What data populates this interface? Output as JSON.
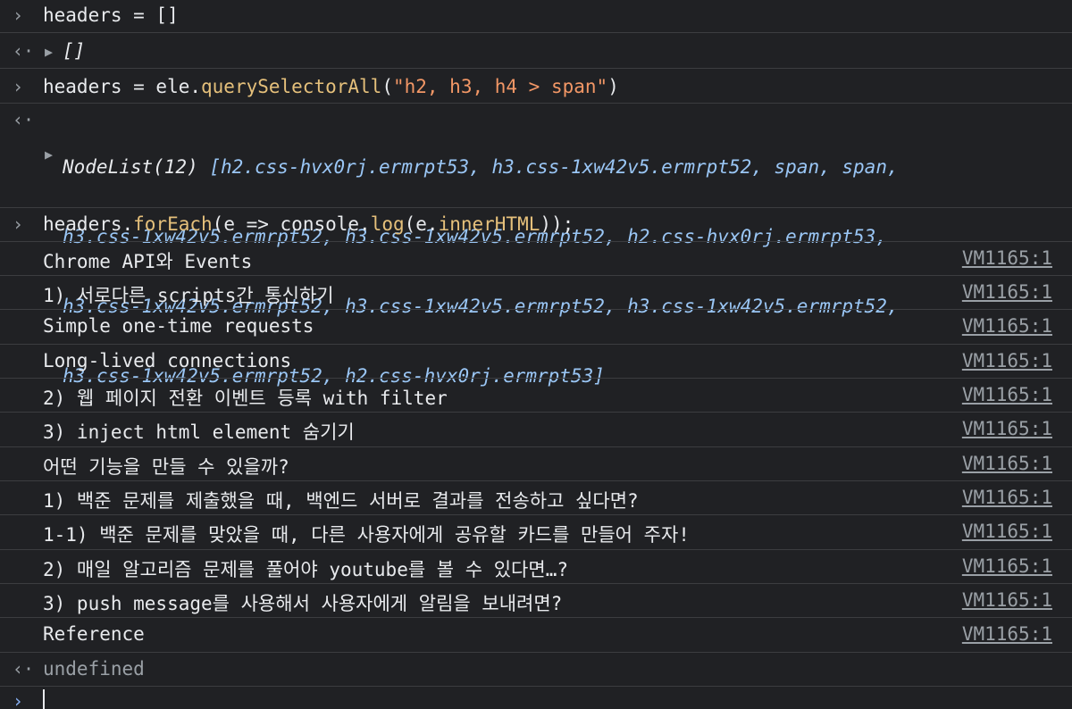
{
  "icons": {
    "input": "›",
    "result": "‹·",
    "expand": "▶"
  },
  "cmd1": {
    "text": "headers = []",
    "result": "[]"
  },
  "cmd2": {
    "lhs": "headers = ele.",
    "method": "querySelectorAll",
    "open": "(",
    "arg": "\"h2, h3, h4 > span\"",
    "close": ")"
  },
  "nodelist": {
    "prefix": "NodeList(12) ",
    "lines": [
      "[h2.css-hvx0rj.ermrpt53, h3.css-1xw42v5.ermrpt52, span, span,",
      "h3.css-1xw42v5.ermrpt52, h3.css-1xw42v5.ermrpt52, h2.css-hvx0rj.ermrpt53,",
      "h3.css-1xw42v5.ermrpt52, h3.css-1xw42v5.ermrpt52, h3.css-1xw42v5.ermrpt52,",
      "h3.css-1xw42v5.ermrpt52, h2.css-hvx0rj.ermrpt53]"
    ]
  },
  "cmd3": {
    "p1": "headers.",
    "p2": "forEach",
    "p3": "(e => console.",
    "p4": "log",
    "p5": "(e.",
    "p6": "innerHTML",
    "p7": "));"
  },
  "logs": [
    {
      "text": "Chrome API와 Events",
      "source": "VM1165:1"
    },
    {
      "text": "1) 서로다른 scripts간 통신하기",
      "source": "VM1165:1"
    },
    {
      "text": "Simple one-time requests",
      "source": "VM1165:1"
    },
    {
      "text": "Long-lived connections",
      "source": "VM1165:1"
    },
    {
      "text": "2) 웹 페이지 전환 이벤트 등록 with filter",
      "source": "VM1165:1"
    },
    {
      "text": "3) inject html element 숨기기",
      "source": "VM1165:1"
    },
    {
      "text": "어떤 기능을 만들 수 있을까?",
      "source": "VM1165:1"
    },
    {
      "text": "1) 백준 문제를 제출했을 때, 백엔드 서버로 결과를 전송하고 싶다면?",
      "source": "VM1165:1"
    },
    {
      "text": "1-1) 백준 문제를 맞았을 때, 다른 사용자에게 공유할 카드를 만들어 주자!",
      "source": "VM1165:1"
    },
    {
      "text": "2) 매일 알고리즘 문제를 풀어야 youtube를 볼 수 있다면…?",
      "source": "VM1165:1"
    },
    {
      "text": "3) push message를 사용해서 사용자에게 알림을 보내려면?",
      "source": "VM1165:1"
    },
    {
      "text": "Reference",
      "source": "VM1165:1"
    }
  ],
  "final_result": "undefined",
  "colors": {
    "background": "#202124",
    "text": "#e8eaed",
    "string": "#f29766",
    "method": "#e5c07b",
    "node": "#9ac6f5",
    "muted": "#9aa0a6"
  }
}
